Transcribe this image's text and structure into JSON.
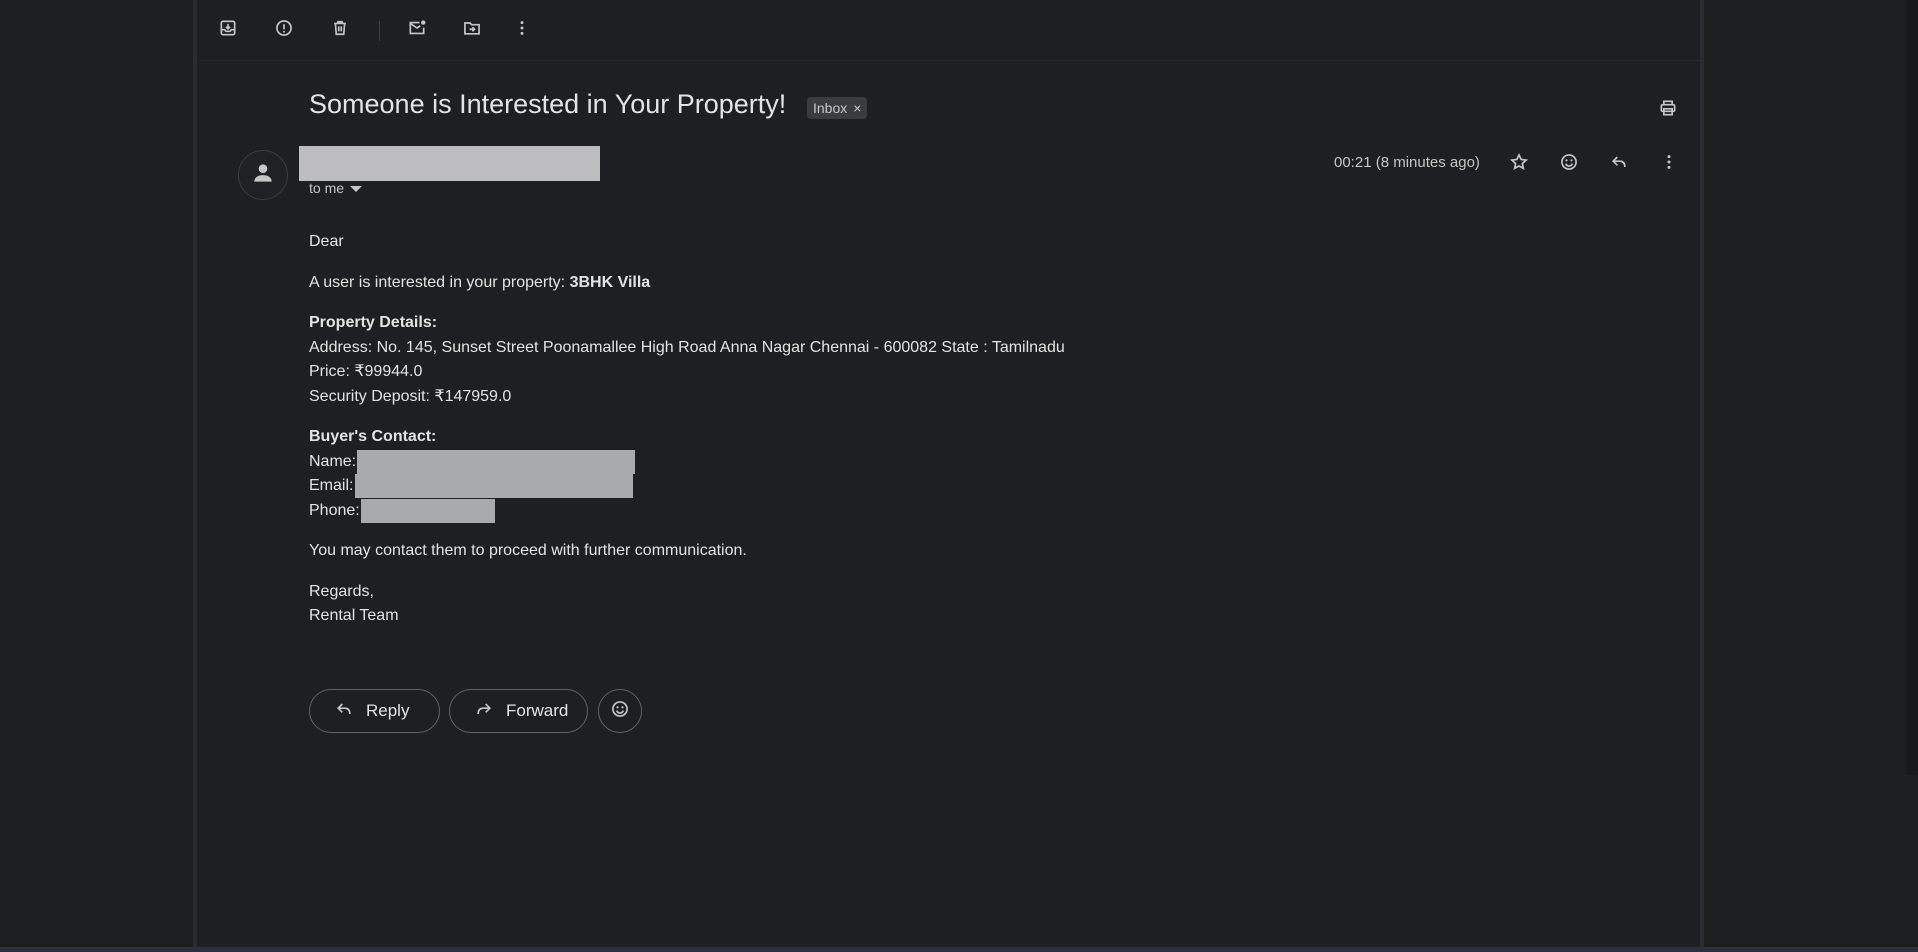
{
  "toolbar": {
    "icons": [
      "archive-icon",
      "report-spam-icon",
      "delete-icon",
      "mark-unread-icon",
      "move-to-icon",
      "more-vert-icon"
    ]
  },
  "message": {
    "subject": "Someone is Interested in Your Property!",
    "label_chip": "Inbox",
    "label_remove": "×",
    "recipient": "to me",
    "timestamp": "00:21 (8 minutes ago)"
  },
  "body": {
    "greeting": "Dear",
    "intro_prefix": "A user is interested in your property: ",
    "property_name": "3BHK Villa",
    "details_heading": "Property Details:",
    "address": "Address: No. 145, Sunset Street Poonamallee High Road Anna Nagar Chennai - 600082 State : Tamilnadu",
    "price": "Price: ₹99944.0",
    "deposit": "Security Deposit: ₹147959.0",
    "contact_heading": "Buyer's Contact:",
    "name_label": "Name:",
    "email_label": "Email:",
    "phone_label": "Phone:",
    "closing_line": "You may contact them to proceed with further communication.",
    "signoff": "Regards,",
    "signature": "Rental Team"
  },
  "actions": {
    "reply_label": "Reply",
    "forward_label": "Forward"
  },
  "colors": {
    "background": "#1e1f21",
    "pane": "#1d1f22",
    "text": "#e3e3e3",
    "muted_text": "#c4c7c5",
    "redaction": "#bdbdbf"
  }
}
